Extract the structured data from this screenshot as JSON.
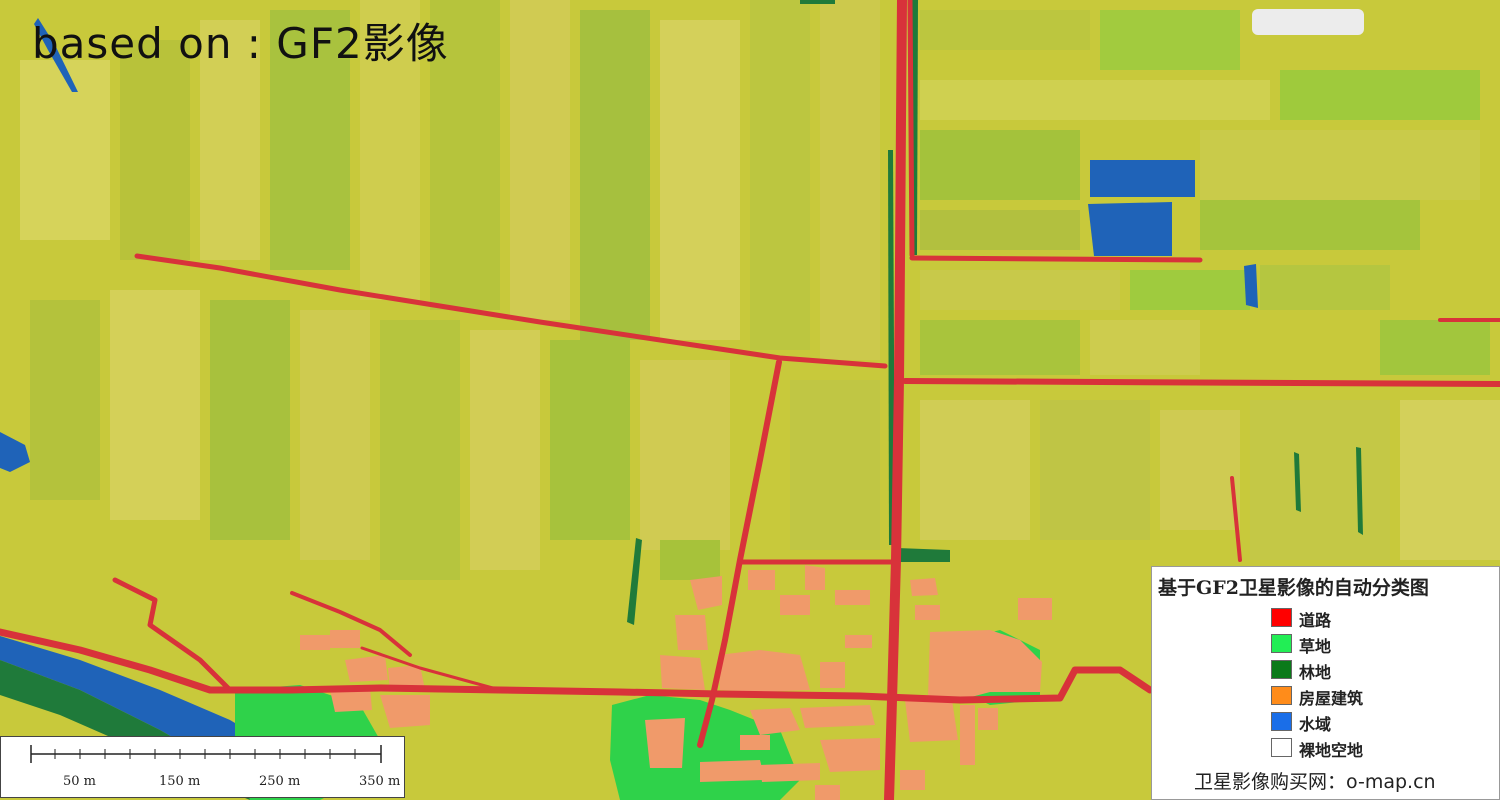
{
  "header": {
    "text": "based on : GF2影像"
  },
  "legend": {
    "title": "基于GF2卫星影像的自动分类图",
    "items": [
      {
        "label": "道路",
        "color": "#ff0000"
      },
      {
        "label": "草地",
        "color": "#22ee55"
      },
      {
        "label": "林地",
        "color": "#0b7a1a"
      },
      {
        "label": "房屋建筑",
        "color": "#ff8c1a"
      },
      {
        "label": "水域",
        "color": "#1a6ee8"
      },
      {
        "label": "裸地空地",
        "color": "#ffffff"
      }
    ],
    "footer": "卫星影像购买网：o-map.cn"
  },
  "scalebar": {
    "labels": [
      "50 m",
      "150 m",
      "250 m",
      "350 m"
    ]
  },
  "colors": {
    "farmland": "#c9c93a",
    "farmland_light": "#d8d45a",
    "farmland_green": "#a9c63a",
    "road": "#d8323a",
    "grass": "#2fd24a",
    "forest": "#1f7a3a",
    "building": "#f09a6a",
    "water": "#1f63b8"
  }
}
